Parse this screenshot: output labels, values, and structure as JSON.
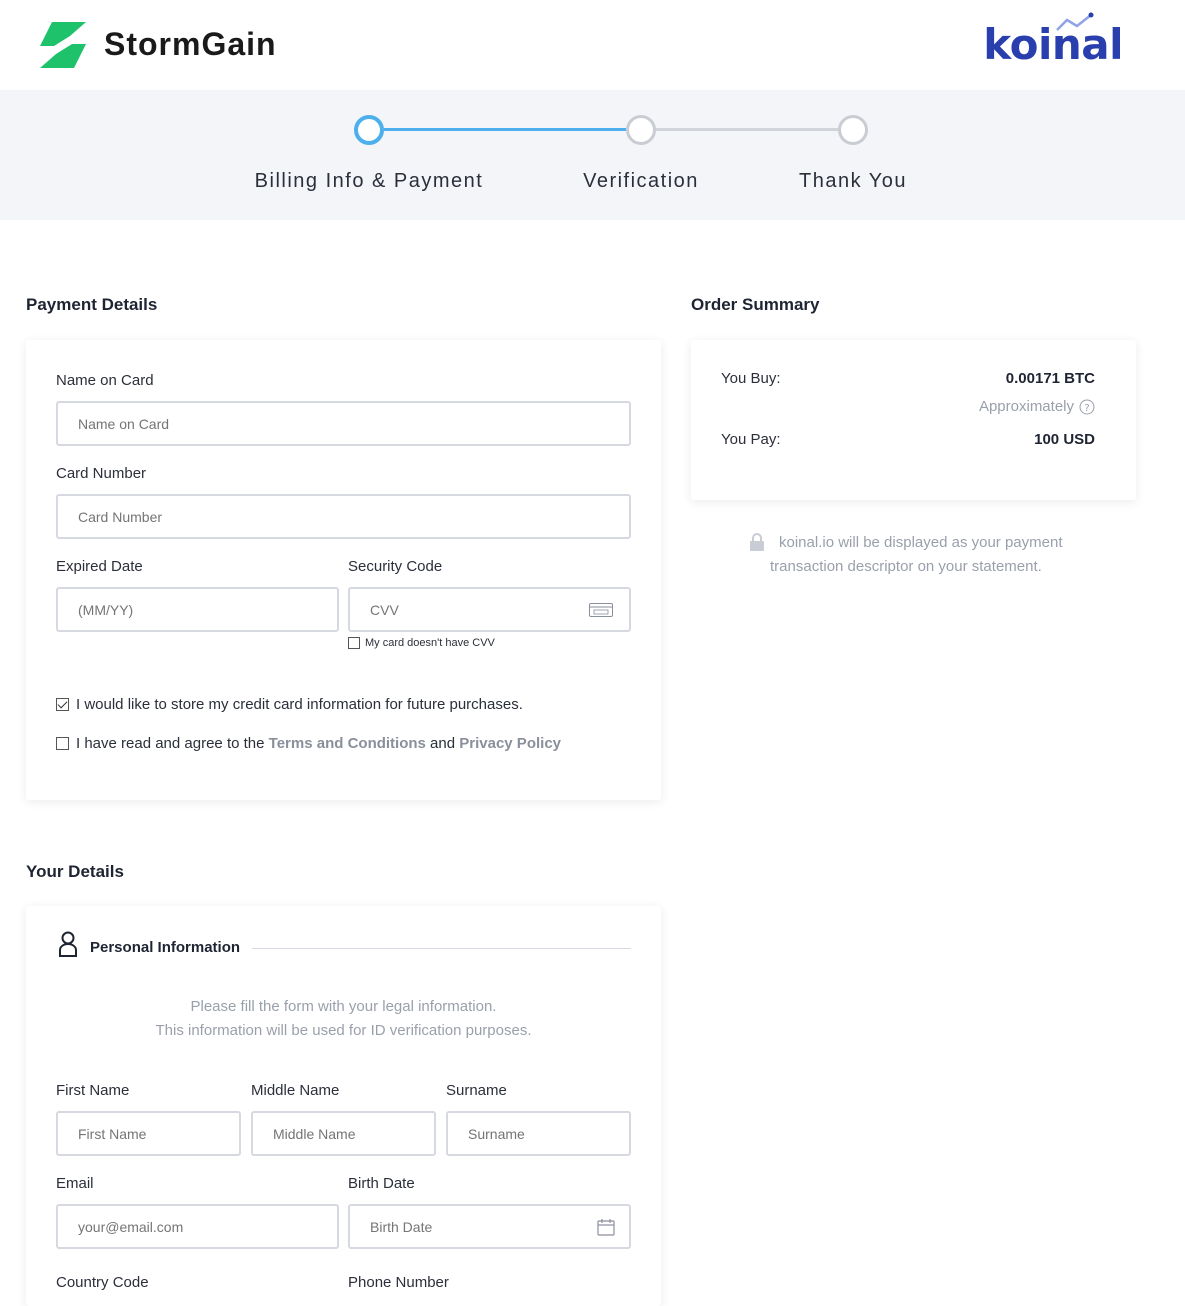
{
  "header": {
    "brand_name": "StormGain",
    "partner_name": "koinal"
  },
  "steps": [
    {
      "label": "Billing Info & Payment",
      "active": true
    },
    {
      "label": "Verification",
      "active": false
    },
    {
      "label": "Thank You",
      "active": false
    }
  ],
  "payment": {
    "title": "Payment Details",
    "name_label": "Name on Card",
    "name_placeholder": "Name on Card",
    "card_label": "Card Number",
    "card_placeholder": "Card Number",
    "exp_label": "Expired Date",
    "exp_placeholder": "(MM/YY)",
    "cvv_label": "Security Code",
    "cvv_placeholder": "CVV",
    "no_cvv_label": "My card doesn't have CVV",
    "store_label": "I would like to store my credit card information for future purchases.",
    "store_checked": true,
    "agree_prefix": "I have read and agree to the ",
    "terms_link": "Terms and Conditions",
    "agree_and": " and ",
    "privacy_link": "Privacy Policy",
    "agree_checked": false
  },
  "summary": {
    "title": "Order Summary",
    "buy_label": "You Buy:",
    "buy_value": "0.00171 BTC",
    "approx_label": "Approximately",
    "pay_label": "You Pay:",
    "pay_value": "100 USD",
    "descriptor_line1": "koinal.io will be displayed as your payment",
    "descriptor_line2": "transaction descriptor on your statement."
  },
  "details": {
    "title": "Your Details",
    "personal_title": "Personal Information",
    "note_line1": "Please fill the form with your legal information.",
    "note_line2": "This information will be used for ID verification purposes.",
    "first_label": "First Name",
    "first_placeholder": "First Name",
    "middle_label": "Middle Name",
    "middle_placeholder": "Middle Name",
    "surname_label": "Surname",
    "surname_placeholder": "Surname",
    "email_label": "Email",
    "email_placeholder": "your@email.com",
    "birth_label": "Birth Date",
    "birth_placeholder": "Birth Date",
    "country_label": "Country Code",
    "phone_label": "Phone Number"
  },
  "colors": {
    "accent_blue": "#4db0ec",
    "brand_green": "#1ec26b",
    "partner_blue": "#2a3fae"
  }
}
